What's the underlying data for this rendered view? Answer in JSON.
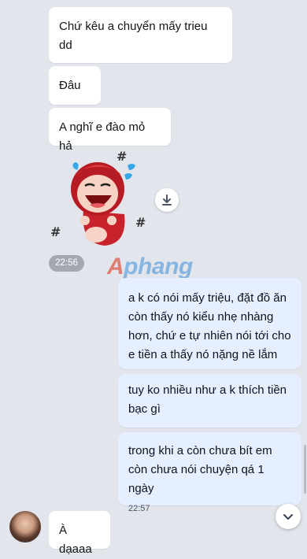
{
  "messages_received": [
    {
      "text": "Chứ kêu a chuyển mấy trieu dd"
    },
    {
      "text": "Đâu"
    },
    {
      "text": "A nghĩ e đào mỏ hả"
    }
  ],
  "sticker": {
    "icon": "crying-laughing-sticker",
    "time": "22:56"
  },
  "watermark": "Aphang",
  "messages_sent": [
    {
      "text": "a k có nói mấy triệu, đặt đồ ăn còn thấy nó kiểu nhẹ nhàng hơn, chứ e tự nhiên nói tới cho e tiền a thấy nó nặng nề lắm"
    },
    {
      "text": "tuy ko nhiều như a k thích tiền bạc gì"
    },
    {
      "text": "trong khi a còn chưa bít em còn chưa nói chuyện qá 1 ngày",
      "time": "22:57"
    }
  ],
  "last_received": {
    "text": "À dạaaa"
  },
  "colors": {
    "background": "#e2e5eb",
    "sent_bubble": "#e5efff",
    "received_bubble": "#ffffff"
  }
}
